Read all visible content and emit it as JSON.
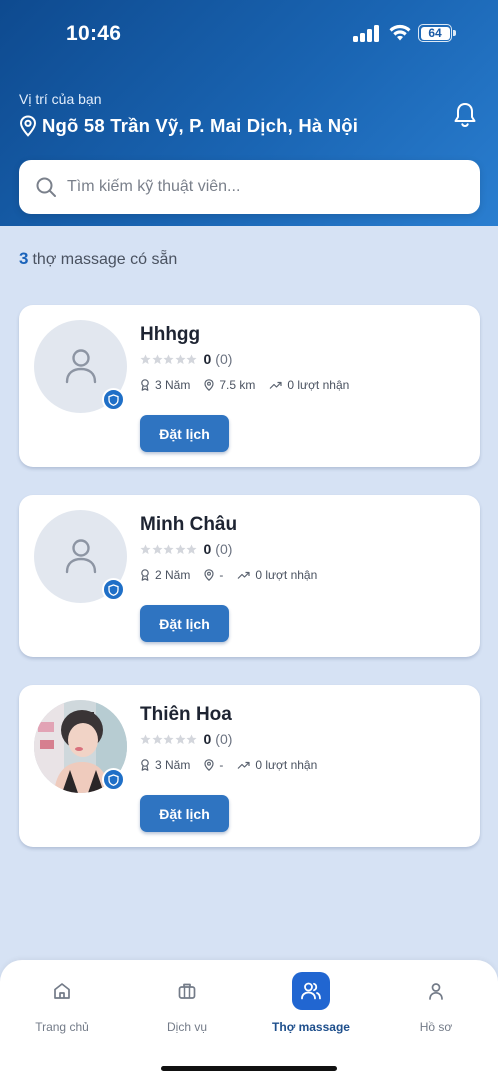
{
  "status_bar": {
    "time": "10:46",
    "battery": "64"
  },
  "header": {
    "location_label": "Vị trí của bạn",
    "location": "Ngõ 58 Trần Vỹ, P. Mai Dịch, Hà Nội"
  },
  "search": {
    "placeholder": "Tìm kiếm kỹ thuật viên..."
  },
  "summary": {
    "count": "3",
    "text": "thợ massage có sẵn"
  },
  "therapists": [
    {
      "name": "Hhhgg",
      "rating": "0",
      "reviews": "(0)",
      "experience": "3 Năm",
      "distance": "7.5 km",
      "bookings": "0 lượt nhận",
      "button": "Đặt lịch"
    },
    {
      "name": "Minh Châu",
      "rating": "0",
      "reviews": "(0)",
      "experience": "2 Năm",
      "distance": "-",
      "bookings": "0 lượt nhận",
      "button": "Đặt lịch"
    },
    {
      "name": "Thiên Hoa",
      "rating": "0",
      "reviews": "(0)",
      "experience": "3 Năm",
      "distance": "-",
      "bookings": "0 lượt nhận",
      "button": "Đặt lịch"
    }
  ],
  "nav": {
    "items": [
      {
        "label": "Trang chủ",
        "icon": "home-icon"
      },
      {
        "label": "Dịch vụ",
        "icon": "briefcase-icon"
      },
      {
        "label": "Thợ massage",
        "icon": "users-icon"
      },
      {
        "label": "Hồ sơ",
        "icon": "user-icon"
      }
    ],
    "active": "Thợ massage"
  },
  "colors": {
    "primary": "#2f74c1",
    "header_start": "#0e4a8f",
    "header_end": "#2a7ed0",
    "background": "#d6e2f4",
    "accent_count": "#1a63ba"
  }
}
